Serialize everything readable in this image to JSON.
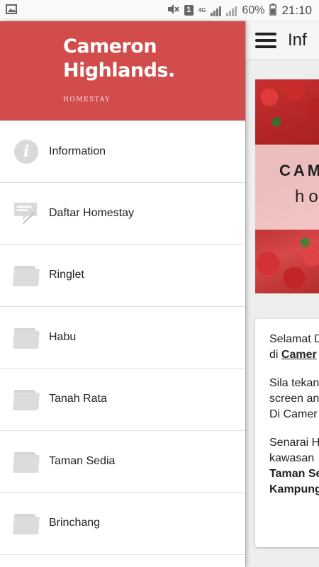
{
  "status_bar": {
    "signal_type": "4G",
    "battery": "60%",
    "time": "21:10",
    "sim": "1"
  },
  "drawer": {
    "brand": {
      "title_line1": "Cameron",
      "title_line2": "Highlands.",
      "subtitle": "HOMESTAY",
      "header_color": "#d24c4c"
    },
    "items": [
      {
        "label": "Information",
        "icon": "info-icon"
      },
      {
        "label": "Daftar Homestay",
        "icon": "edit-form-icon"
      },
      {
        "label": "Ringlet",
        "icon": "folder-icon"
      },
      {
        "label": "Habu",
        "icon": "folder-icon"
      },
      {
        "label": "Tanah Rata",
        "icon": "folder-icon"
      },
      {
        "label": "Taman Sedia",
        "icon": "folder-icon"
      },
      {
        "label": "Brinchang",
        "icon": "folder-icon"
      }
    ]
  },
  "main": {
    "app_bar_title": "Inf",
    "banner": {
      "title": "CAM",
      "subtitle": "ho"
    },
    "card": {
      "line1": "Selamat D",
      "line2_prefix": "di ",
      "line2_link": "Camer",
      "line3": "Sila tekan",
      "line4": "screen an",
      "line5": "Di Camer",
      "line6": "Senarai H",
      "line7": "kawasan",
      "line8": "Taman Se",
      "line9": "Kampung"
    }
  }
}
